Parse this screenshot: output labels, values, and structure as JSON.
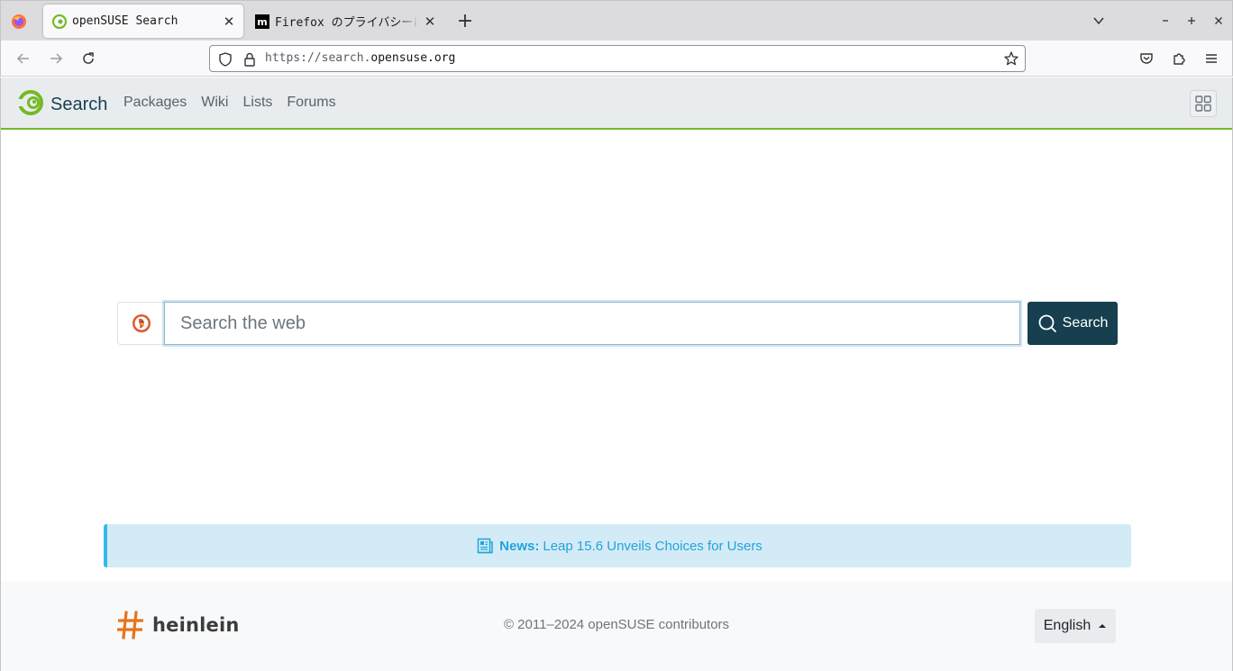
{
  "browser": {
    "tabs": [
      {
        "title": "openSUSE Search",
        "active": true
      },
      {
        "title": "Firefox のプライバシーに関する通知",
        "active": false
      }
    ],
    "url_scheme": "https://search.",
    "url_host": "opensuse.org"
  },
  "site": {
    "brand": "Search",
    "nav": [
      "Packages",
      "Wiki",
      "Lists",
      "Forums"
    ],
    "accent_color": "#73ba25",
    "primary_color": "#173f4f"
  },
  "search": {
    "placeholder": "Search the web",
    "button_label": "Search"
  },
  "news": {
    "label": "News:",
    "headline": "Leap 15.6 Unveils Choices for Users"
  },
  "footer": {
    "sponsor": "heinlein",
    "copyright": "© 2011–2024 openSUSE contributors",
    "language": "English"
  }
}
